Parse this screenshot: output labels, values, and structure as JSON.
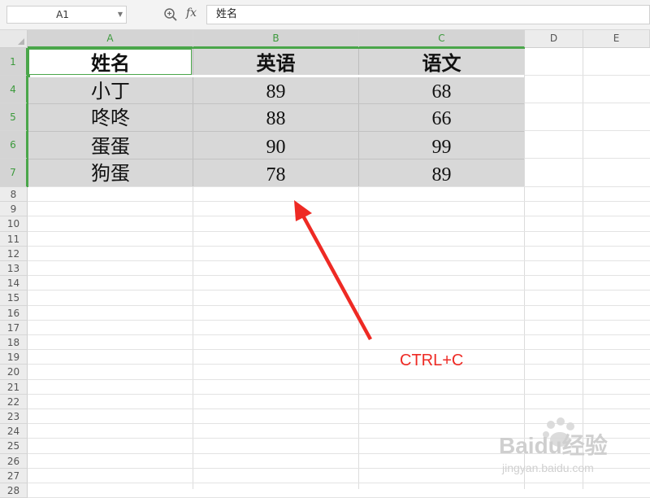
{
  "toolbar": {
    "name_box": "A1",
    "fx_label": "fx",
    "formula_value": "姓名"
  },
  "columns": [
    "A",
    "B",
    "C",
    "D",
    "E"
  ],
  "rows_header": [
    "1",
    "4",
    "5",
    "6",
    "7"
  ],
  "empty_rows": [
    "8",
    "9",
    "10",
    "11",
    "12",
    "13",
    "14",
    "15",
    "16",
    "17",
    "18",
    "19",
    "20",
    "21",
    "22",
    "23",
    "24",
    "25",
    "26",
    "27",
    "28"
  ],
  "table": {
    "header": [
      "姓名",
      "英语",
      "语文"
    ],
    "rows": [
      [
        "小丁",
        "89",
        "68"
      ],
      [
        "咚咚",
        "88",
        "66"
      ],
      [
        "蛋蛋",
        "90",
        "99"
      ],
      [
        "狗蛋",
        "78",
        "89"
      ]
    ]
  },
  "annotation": "CTRL+C",
  "colors": {
    "selection_green": "#4aa64a",
    "annotation_red": "#ee2a24",
    "selection_fill": "#d8d8d8"
  },
  "watermark": {
    "logo": "Baidu经验",
    "url": "jingyan.baidu.com"
  }
}
